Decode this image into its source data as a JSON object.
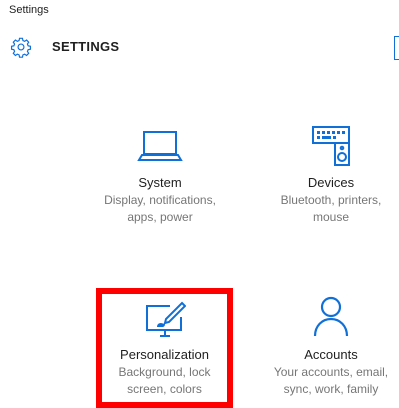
{
  "window": {
    "title": "Settings"
  },
  "header": {
    "title": "SETTINGS",
    "icon": "gear-icon"
  },
  "tiles": [
    {
      "name": "System",
      "desc1": "Display, notifications,",
      "desc2": "apps, power",
      "icon": "laptop-icon"
    },
    {
      "name": "Devices",
      "desc1": "Bluetooth, printers,",
      "desc2": "mouse",
      "icon": "keyboard-speaker-icon"
    },
    {
      "name": "Personalization",
      "desc1": "Background, lock",
      "desc2": "screen, colors",
      "icon": "paint-monitor-icon"
    },
    {
      "name": "Accounts",
      "desc1": "Your accounts, email,",
      "desc2": "sync, work, family",
      "icon": "person-icon"
    }
  ],
  "colors": {
    "accent": "#1070d8",
    "highlight": "#ff0000",
    "desc_text": "#767676"
  }
}
